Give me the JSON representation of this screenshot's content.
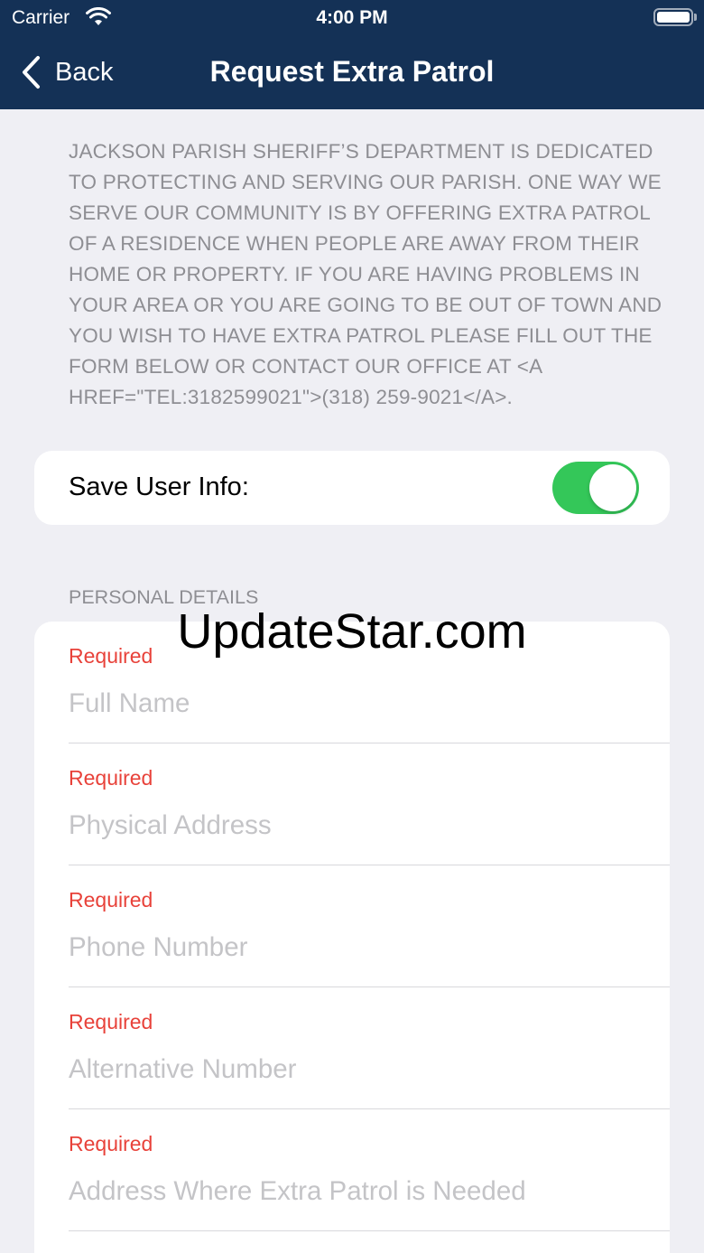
{
  "status_bar": {
    "carrier": "Carrier",
    "time": "4:00 PM"
  },
  "nav": {
    "back_label": "Back",
    "title": "Request Extra Patrol"
  },
  "intro_text": "JACKSON PARISH SHERIFF’S DEPARTMENT IS DEDICATED TO PROTECTING AND SERVING OUR PARISH. ONE WAY WE SERVE OUR COMMUNITY IS BY OFFERING EXTRA PATROL OF A RESIDENCE WHEN PEOPLE ARE AWAY FROM THEIR HOME OR PROPERTY. IF YOU ARE HAVING PROBLEMS IN YOUR AREA OR YOU ARE GOING TO BE OUT OF TOWN AND YOU WISH TO HAVE EXTRA PATROL PLEASE FILL OUT THE FORM BELOW OR CONTACT OUR OFFICE AT <A HREF=\"TEL:3182599021\">(318) 259-9021</A>.",
  "save_user_info": {
    "label": "Save User Info:",
    "enabled": true
  },
  "personal_details": {
    "header": "PERSONAL DETAILS",
    "fields": [
      {
        "required_label": "Required",
        "placeholder": "Full Name",
        "value": ""
      },
      {
        "required_label": "Required",
        "placeholder": "Physical Address",
        "value": ""
      },
      {
        "required_label": "Required",
        "placeholder": "Phone Number",
        "value": ""
      },
      {
        "required_label": "Required",
        "placeholder": "Alternative Number",
        "value": ""
      },
      {
        "required_label": "Required",
        "placeholder": "Address Where Extra Patrol is Needed",
        "value": ""
      }
    ]
  },
  "watermark": "UpdateStar.com",
  "colors": {
    "nav_background": "#143156",
    "page_background": "#efeff4",
    "toggle_on": "#34c759",
    "required_text": "#e8423a"
  }
}
